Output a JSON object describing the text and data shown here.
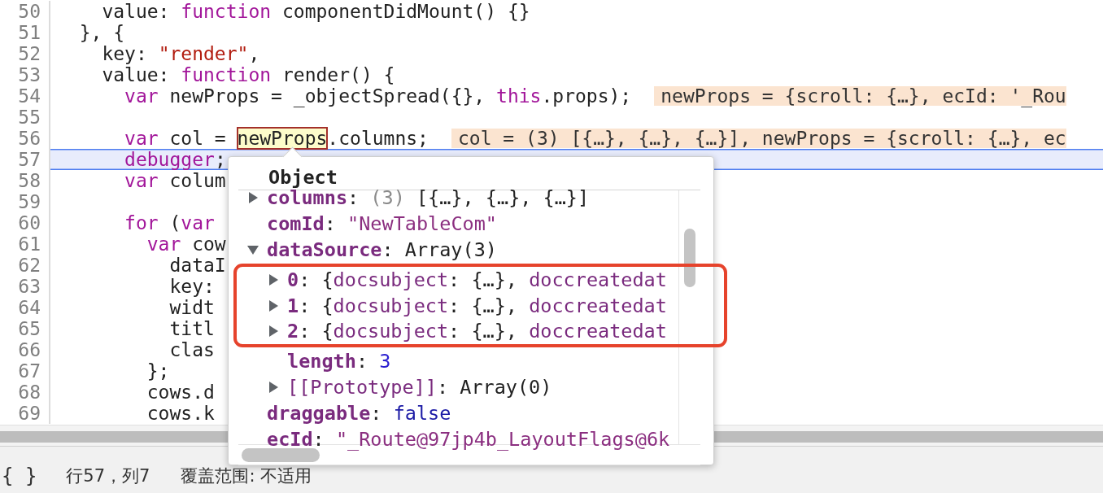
{
  "editor": {
    "lines": [
      {
        "number": "50",
        "current": false,
        "tokens": [
          {
            "text": "    value: ",
            "kind": "plain"
          },
          {
            "text": "function",
            "kind": "keyword"
          },
          {
            "text": " componentDidMount() {}",
            "kind": "plain"
          }
        ]
      },
      {
        "number": "51",
        "current": false,
        "tokens": [
          {
            "text": "  }, {",
            "kind": "plain"
          }
        ]
      },
      {
        "number": "52",
        "current": false,
        "tokens": [
          {
            "text": "    key: ",
            "kind": "plain"
          },
          {
            "text": "\"render\"",
            "kind": "string"
          },
          {
            "text": ",",
            "kind": "plain"
          }
        ]
      },
      {
        "number": "53",
        "current": false,
        "tokens": [
          {
            "text": "    value: ",
            "kind": "plain"
          },
          {
            "text": "function",
            "kind": "keyword"
          },
          {
            "text": " render() {",
            "kind": "plain"
          }
        ]
      },
      {
        "number": "54",
        "current": false,
        "tokens": [
          {
            "text": "      var",
            "kind": "keyword"
          },
          {
            "text": " newProps = _objectSpread({}, ",
            "kind": "plain"
          },
          {
            "text": "this",
            "kind": "keyword"
          },
          {
            "text": ".props);",
            "kind": "plain"
          }
        ],
        "inline_value": "newProps = {scroll: {…}, ecId: '_Rou"
      },
      {
        "number": "55",
        "current": false
      },
      {
        "number": "56",
        "current": false,
        "tokens": [
          {
            "text": "      var",
            "kind": "keyword"
          },
          {
            "text": " col = ",
            "kind": "plain"
          },
          {
            "text": "newProps",
            "kind": "hovered"
          },
          {
            "text": ".columns;",
            "kind": "plain"
          }
        ],
        "inline_value": "col = (3) [{…}, {…}, {…}], newProps = {scroll: {…}, ec"
      },
      {
        "number": "57",
        "current": true,
        "tokens": [
          {
            "text": "      debugger",
            "kind": "keyword"
          },
          {
            "text": ";",
            "kind": "plain"
          }
        ]
      },
      {
        "number": "58",
        "current": false,
        "tokens": [
          {
            "text": "      var",
            "kind": "keyword"
          },
          {
            "text": " colum",
            "kind": "plain"
          }
        ]
      },
      {
        "number": "59",
        "current": false
      },
      {
        "number": "60",
        "current": false,
        "tokens": [
          {
            "text": "      for",
            "kind": "keyword"
          },
          {
            "text": " (",
            "kind": "plain"
          },
          {
            "text": "var",
            "kind": "keyword"
          }
        ]
      },
      {
        "number": "61",
        "current": false,
        "tokens": [
          {
            "text": "        var",
            "kind": "keyword"
          },
          {
            "text": " cow",
            "kind": "plain"
          }
        ]
      },
      {
        "number": "62",
        "current": false,
        "tokens": [
          {
            "text": "          dataI",
            "kind": "plain"
          }
        ]
      },
      {
        "number": "63",
        "current": false,
        "tokens": [
          {
            "text": "          key:",
            "kind": "plain"
          }
        ]
      },
      {
        "number": "64",
        "current": false,
        "tokens": [
          {
            "text": "          widt",
            "kind": "plain"
          }
        ]
      },
      {
        "number": "65",
        "current": false,
        "tokens": [
          {
            "text": "          titl",
            "kind": "plain"
          }
        ]
      },
      {
        "number": "66",
        "current": false,
        "tokens": [
          {
            "text": "          clas",
            "kind": "plain"
          }
        ]
      },
      {
        "number": "67",
        "current": false,
        "tokens": [
          {
            "text": "        };",
            "kind": "plain"
          }
        ]
      },
      {
        "number": "68",
        "current": false,
        "tokens": [
          {
            "text": "        cows.d",
            "kind": "plain"
          }
        ]
      },
      {
        "number": "69",
        "current": false,
        "tokens": [
          {
            "text": "        cows.k",
            "kind": "plain"
          }
        ]
      }
    ]
  },
  "popover": {
    "title": "Object",
    "properties": [
      {
        "key": "columns",
        "kind": "own",
        "expanded": false,
        "value": [
          {
            "text": ": ",
            "kind": "plain"
          },
          {
            "text": "(3)",
            "kind": "dim"
          },
          {
            "text": " [{…}, {…}, {…}]",
            "kind": "plain"
          }
        ]
      },
      {
        "key": "comId",
        "kind": "own",
        "value": [
          {
            "text": ": ",
            "kind": "plain"
          },
          {
            "text": "\"NewTableCom\"",
            "kind": "string"
          }
        ]
      },
      {
        "key": "dataSource",
        "kind": "own",
        "expanded": true,
        "value": [
          {
            "text": ": ",
            "kind": "plain"
          },
          {
            "text": "Array(3)",
            "kind": "plain"
          }
        ],
        "children": [
          {
            "key": "0",
            "kind": "own",
            "expanded": false,
            "annotated": true,
            "value": [
              {
                "text": ": {",
                "kind": "plain"
              },
              {
                "text": "docsubject",
                "kind": "name"
              },
              {
                "text": ": {…}, ",
                "kind": "plain"
              },
              {
                "text": "doccreatedat",
                "kind": "name"
              }
            ]
          },
          {
            "key": "1",
            "kind": "own",
            "expanded": false,
            "annotated": true,
            "value": [
              {
                "text": ": {",
                "kind": "plain"
              },
              {
                "text": "docsubject",
                "kind": "name"
              },
              {
                "text": ": {…}, ",
                "kind": "plain"
              },
              {
                "text": "doccreatedat",
                "kind": "name"
              }
            ]
          },
          {
            "key": "2",
            "kind": "own",
            "expanded": false,
            "annotated": true,
            "value": [
              {
                "text": ": {",
                "kind": "plain"
              },
              {
                "text": "docsubject",
                "kind": "name"
              },
              {
                "text": ": {…}, ",
                "kind": "plain"
              },
              {
                "text": "doccreatedat",
                "kind": "name"
              }
            ]
          },
          {
            "key": "length",
            "kind": "own",
            "annotated": false,
            "value": [
              {
                "text": ": ",
                "kind": "plain"
              },
              {
                "text": "3",
                "kind": "number"
              }
            ]
          },
          {
            "key": "[[Prototype]]",
            "kind": "internal",
            "expanded": false,
            "annotated": false,
            "value": [
              {
                "text": ": ",
                "kind": "plain"
              },
              {
                "text": "Array(0)",
                "kind": "plain"
              }
            ]
          }
        ]
      },
      {
        "key": "draggable",
        "kind": "own",
        "value": [
          {
            "text": ": ",
            "kind": "plain"
          },
          {
            "text": "false",
            "kind": "keyword"
          }
        ]
      },
      {
        "key": "ecId",
        "kind": "own",
        "value": [
          {
            "text": ": ",
            "kind": "plain"
          },
          {
            "text": "\"_Route@97jp4b_LayoutFlags@6k",
            "kind": "string"
          }
        ]
      }
    ]
  },
  "status_bar": {
    "format_button": "{ }",
    "cursor": "行57，列7",
    "coverage": "覆盖范围: 不适用"
  }
}
